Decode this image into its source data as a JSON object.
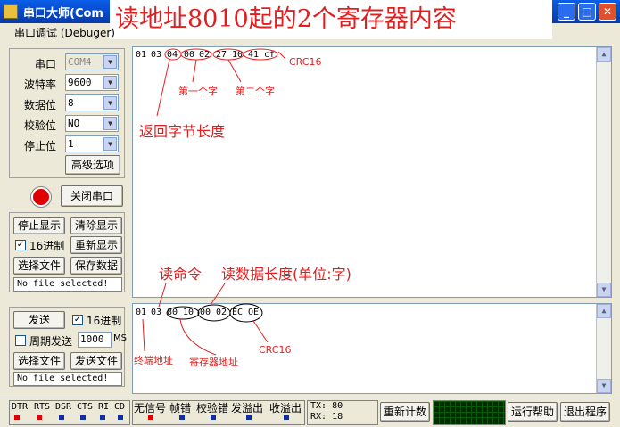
{
  "window": {
    "title": "串口大师(Com",
    "controls": [
      "_",
      "□",
      "✕"
    ]
  },
  "overlay_title": "读地址8010起的2个寄存器内容",
  "menu": {
    "label": "串口调试 (Debuger)"
  },
  "serial": {
    "port_label": "串口",
    "port_value": "COM4",
    "baud_label": "波特率",
    "baud_value": "9600",
    "databits_label": "数据位",
    "databits_value": "8",
    "parity_label": "校验位",
    "parity_value": "NO",
    "stopbits_label": "停止位",
    "stopbits_value": "1",
    "advanced_button": "高级选项",
    "close_port_button": "关闭串口",
    "status_color": "#e00000"
  },
  "receive": {
    "stop_display": "停止显示",
    "clear_display": "清除显示",
    "hex_checkbox": "16进制",
    "hex_checked": "✓",
    "redisplay": "重新显示",
    "choose_file": "选择文件",
    "save_data": "保存数据",
    "file_status": "No file selected!"
  },
  "send": {
    "send_button": "发送",
    "hex_checkbox": "16进制",
    "hex_checked": "✓",
    "periodic": "周期发送",
    "period_value": "1000",
    "period_unit": "MS",
    "choose_file": "选择文件",
    "send_file": "发送文件",
    "file_status": "No file selected!"
  },
  "rx_text": [
    "01",
    "03",
    "04",
    "00",
    "02",
    "27",
    "10",
    "41",
    "cf"
  ],
  "tx_text": [
    "01",
    "03",
    "80",
    "10",
    "00",
    "02",
    "EC",
    "OE"
  ],
  "annotations": {
    "crc_rx": "CRC16",
    "first_word": "第一个字",
    "second_word": "第二个字",
    "return_len": "返回字节长度",
    "read_cmd": "读命令",
    "read_len": "读数据长度(单位:字)",
    "terminal_addr": "终端地址",
    "reg_addr": "寄存器地址",
    "crc_tx": "CRC16"
  },
  "statusbar": {
    "signals": [
      "DTR",
      "RTS",
      "DSR",
      "CTS",
      "RI",
      "CD"
    ],
    "signal_colors": [
      "#e00000",
      "#e00000",
      "#1030a0",
      "#1030a0",
      "#1030a0",
      "#1030a0"
    ],
    "flags": [
      "无信号",
      "帧错",
      "校验错",
      "发溢出",
      "收溢出"
    ],
    "flag_colors": [
      "#e00000",
      "#1030a0",
      "#1030a0",
      "#1030a0",
      "#1030a0"
    ],
    "tx_label": "TX: 80",
    "rx_label": "RX: 18",
    "recount_button": "重新计数",
    "help_button": "运行帮助",
    "exit_button": "退出程序"
  }
}
